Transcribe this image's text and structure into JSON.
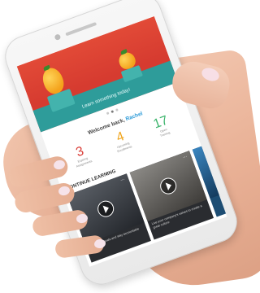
{
  "hero": {
    "caption": "Learn something today!"
  },
  "carousel": {
    "dots": 3,
    "active_index": 1
  },
  "welcome": {
    "text": "Welcome back,",
    "name": "Rachel"
  },
  "stats": [
    {
      "value": "3",
      "label": "Expiring\nAssignments",
      "color": "#d93b35"
    },
    {
      "value": "4",
      "label": "Upcoming\nEnrollments",
      "color": "#f0a51c"
    },
    {
      "value": "17",
      "label": "Open\nTraining",
      "color": "#3cb46c"
    }
  ],
  "section": {
    "title": "CONTINUE LEARNING",
    "more": "›"
  },
  "cards": [
    {
      "text": "How to set goals and stay accountable"
    },
    {
      "text": "Live your company's values to create a great culture"
    },
    {
      "text": ""
    }
  ],
  "colors": {
    "hero_red": "#e24a37",
    "teal": "#2e9c9a",
    "accent_blue": "#2b9ad8"
  }
}
